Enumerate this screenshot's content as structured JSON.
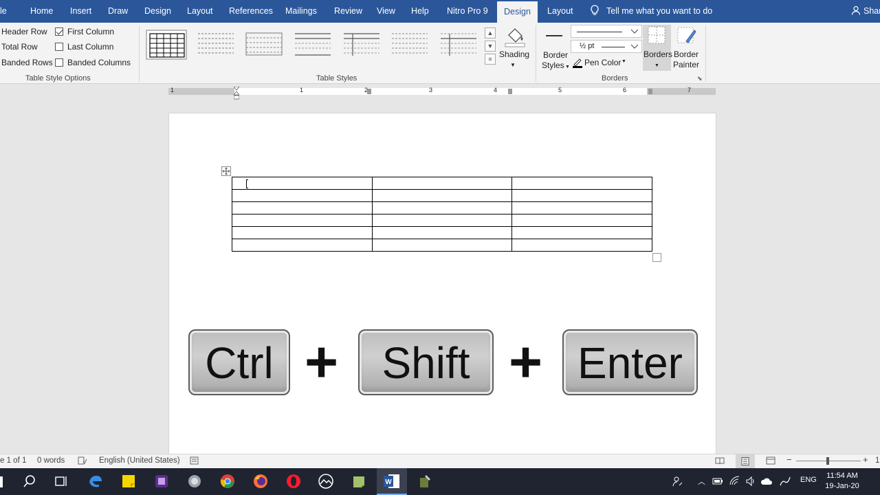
{
  "tabs": [
    "le",
    "Home",
    "Insert",
    "Draw",
    "Design",
    "Layout",
    "References",
    "Mailings",
    "Review",
    "View",
    "Help",
    "Nitro Pro 9",
    "Design",
    "Layout"
  ],
  "tell_me": "Tell me what you want to do",
  "share_label": "Shar",
  "style_options": {
    "header_row": "Header Row",
    "total_row": "Total Row",
    "banded_rows": "Banded Rows",
    "first_column": "First Column",
    "first_column_checked": true,
    "last_column": "Last Column",
    "last_column_checked": false,
    "banded_columns": "Banded Columns",
    "banded_columns_checked": false,
    "group_label": "Table Style Options"
  },
  "table_styles": {
    "group_label": "Table Styles"
  },
  "shading_label": "Shading",
  "borders": {
    "border_styles_line1": "Border",
    "border_styles_line2": "Styles",
    "weight": "½ pt",
    "pen_color": "Pen Color",
    "borders_label": "Borders",
    "painter_line1": "Border",
    "painter_line2": "Painter",
    "group_label": "Borders"
  },
  "ruler_numbers": [
    "1",
    "1",
    "2",
    "3",
    "4",
    "5",
    "6",
    "7"
  ],
  "keys": {
    "key1": "Ctrl",
    "plus1": "+",
    "key2": "Shift",
    "plus2": "+",
    "key3": "Enter"
  },
  "status": {
    "page": "e 1 of 1",
    "words": "0 words",
    "language": "English (United States)",
    "zoom_partial": "1"
  },
  "taskbar": {
    "lang": "ENG",
    "time": "11:54 AM",
    "date": "19-Jan-20"
  },
  "colors": {
    "accent": "#2b579a",
    "taskbar": "#1f2430",
    "word": "#2b579a"
  }
}
